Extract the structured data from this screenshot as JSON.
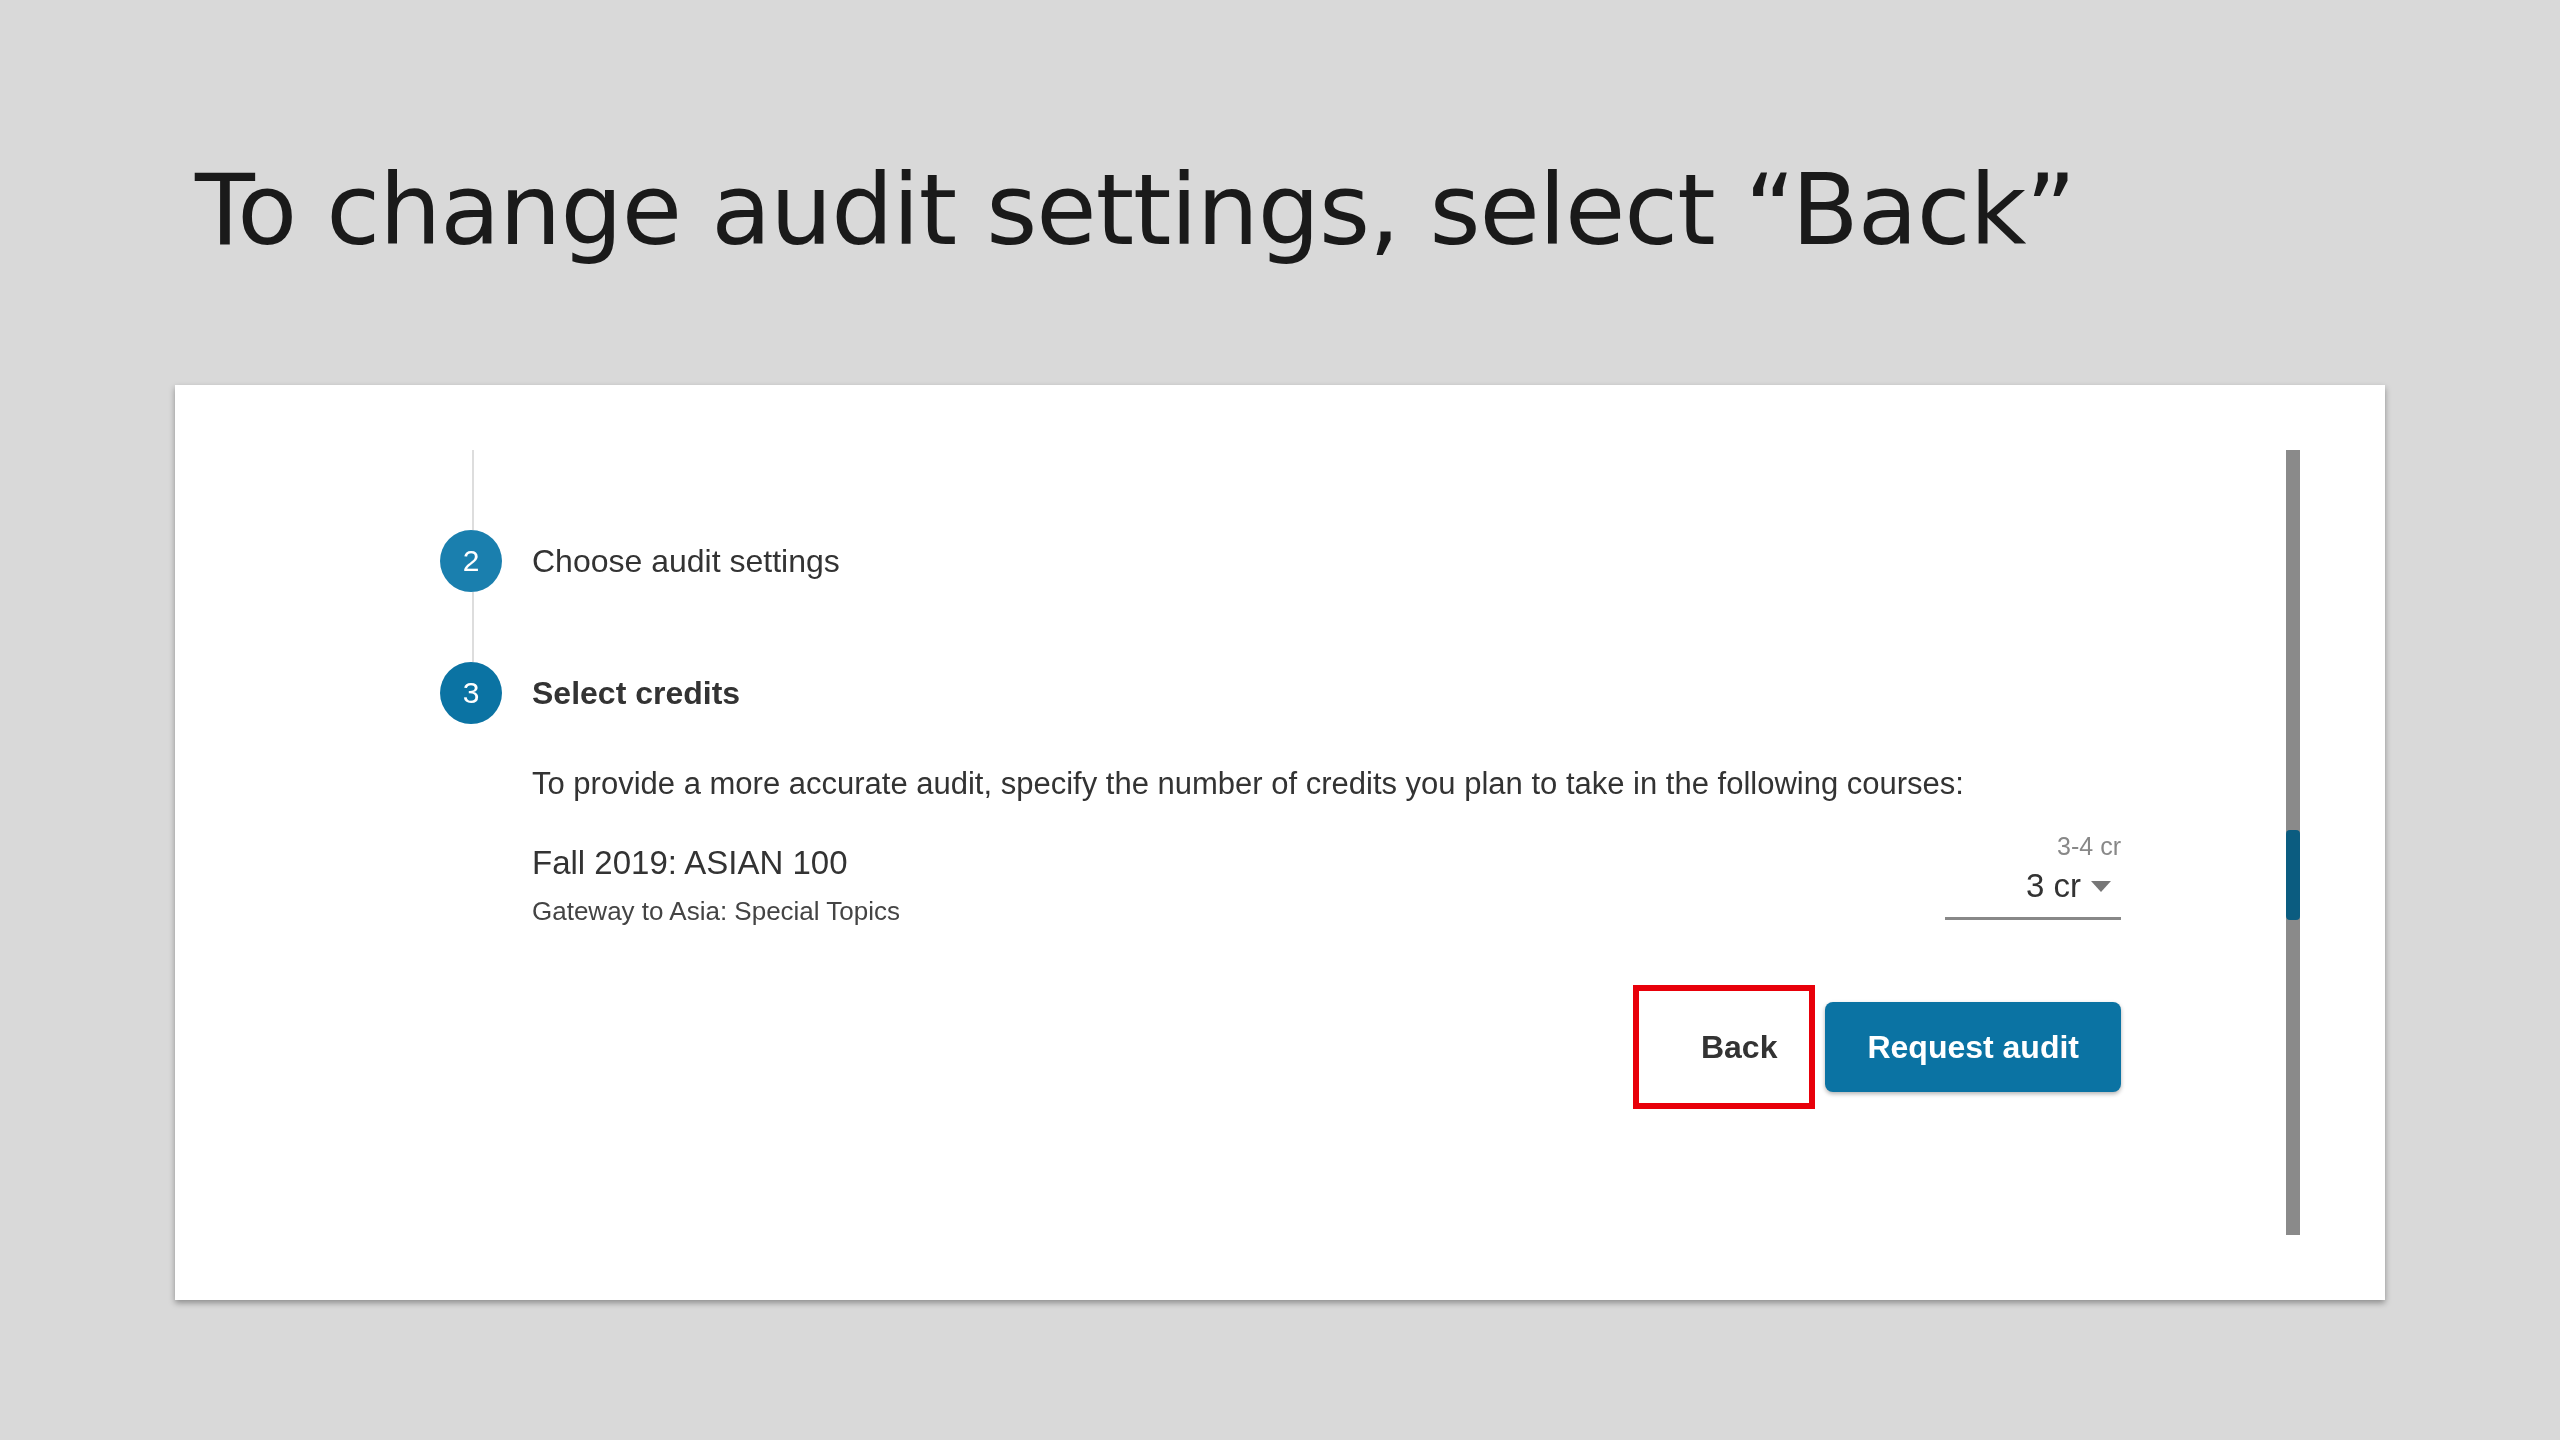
{
  "slide_title": "To change audit settings, select “Back”",
  "steps": [
    {
      "number": "2",
      "label": "Choose audit settings",
      "current": false
    },
    {
      "number": "3",
      "label": "Select credits",
      "current": true
    }
  ],
  "instructions": "To provide a more accurate audit, specify the number of credits you plan to take in the following courses:",
  "course": {
    "title": "Fall 2019: ASIAN 100",
    "subtitle": "Gateway to Asia: Special Topics",
    "credit_range": "3-4 cr",
    "credits": "3 cr"
  },
  "buttons": [
    {
      "kind": "text",
      "label": "Back",
      "highlighted": true
    },
    {
      "kind": "primary",
      "label": "Request audit",
      "highlighted": false
    }
  ]
}
